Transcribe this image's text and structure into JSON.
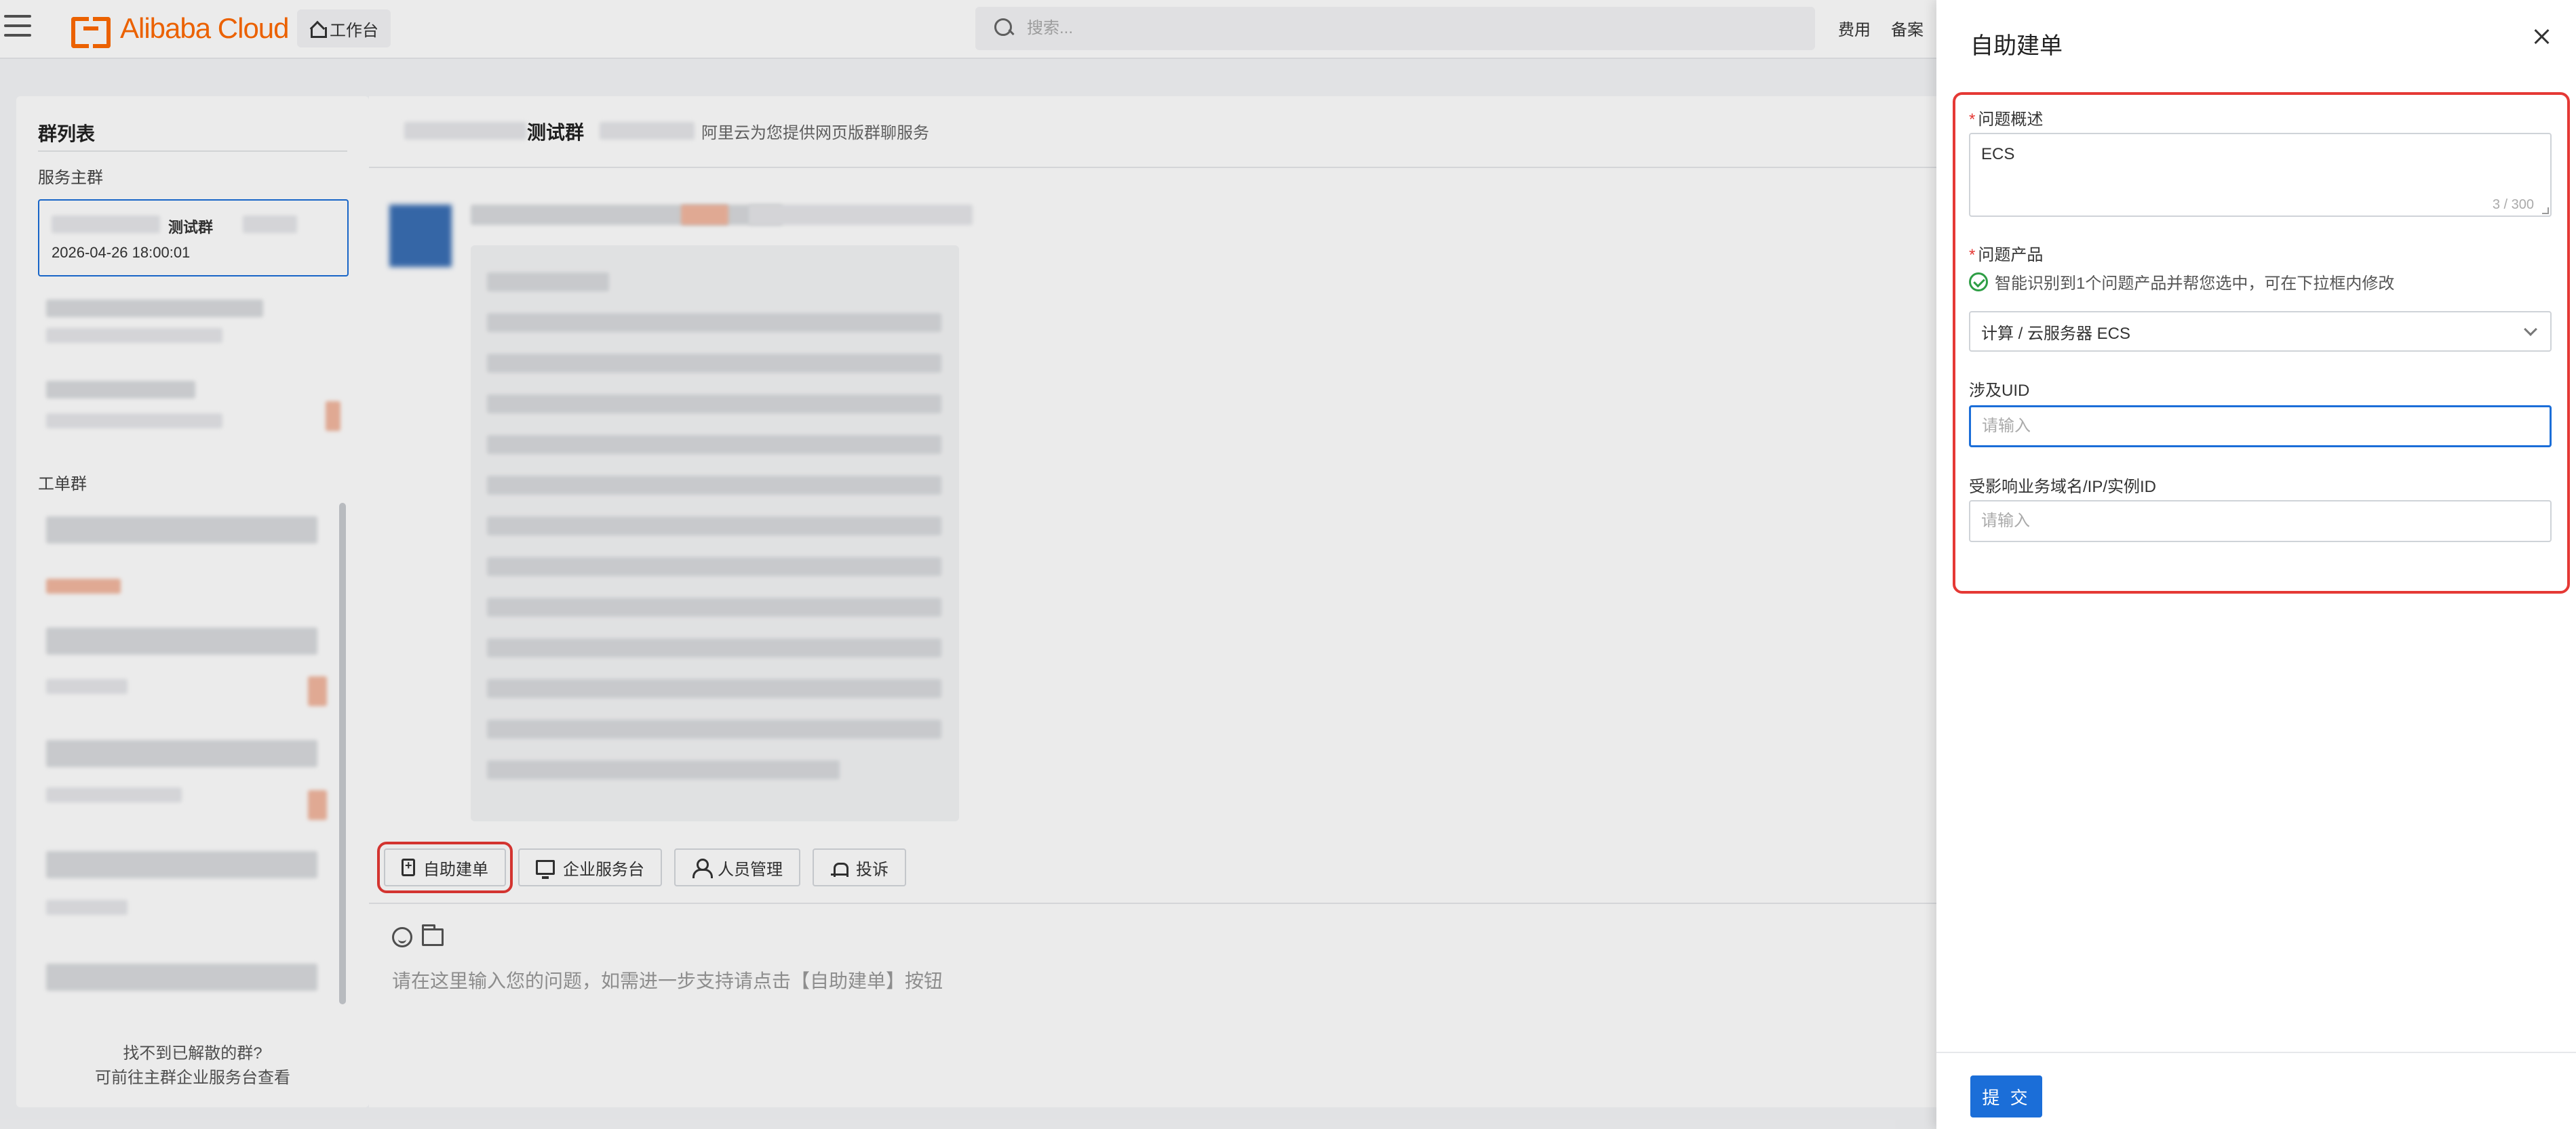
{
  "header": {
    "logo_text": "Alibaba Cloud",
    "workbench_label": "工作台",
    "search_placeholder": "搜索...",
    "nav": [
      "费用",
      "备案"
    ]
  },
  "sidebar": {
    "title": "群列表",
    "section_main": "服务主群",
    "active_group": {
      "name": "测试群",
      "time": "2026-04-26 18:00:01"
    },
    "section_ticket": "工单群",
    "footer_line1": "找不到已解散的群?",
    "footer_line2": "可前往主群企业服务台查看"
  },
  "chat": {
    "group_name": "测试群",
    "description": "阿里云为您提供网页版群聊服务",
    "toolbar": {
      "self_ticket": "自助建单",
      "service_desk": "企业服务台",
      "member_mgmt": "人员管理",
      "complaint": "投诉"
    },
    "input_placeholder": "请在这里输入您的问题，如需进一步支持请点击【自助建单】按钮"
  },
  "drawer": {
    "title": "自助建单",
    "fields": {
      "summary_label": "问题概述",
      "summary_value": "ECS",
      "summary_count": "3 / 300",
      "product_label": "问题产品",
      "product_hint": "智能识别到1个问题产品并帮您选中，可在下拉框内修改",
      "product_value": "计算 / 云服务器 ECS",
      "uid_label": "涉及UID",
      "uid_placeholder": "请输入",
      "affected_label": "受影响业务域名/IP/实例ID",
      "affected_placeholder": "请输入"
    },
    "submit_label": "提 交"
  },
  "colors": {
    "brand_orange": "#ff6a00",
    "primary_blue": "#1b6ed8",
    "highlight_red": "#e53935",
    "success_green": "#2e9e45"
  }
}
